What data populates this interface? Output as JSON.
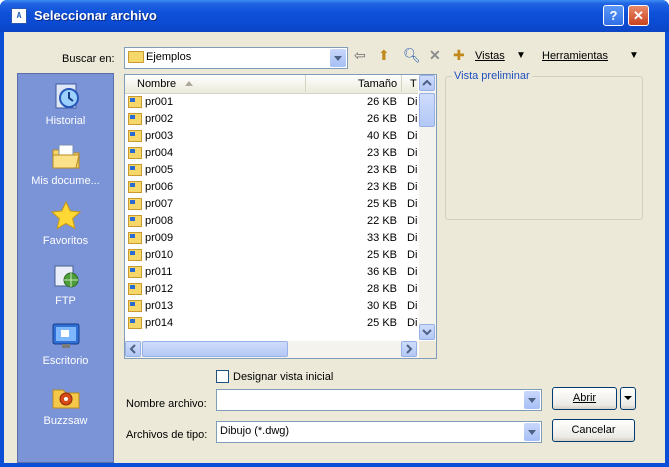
{
  "window": {
    "title": "Seleccionar archivo",
    "help_label": "?",
    "close_label": "✕"
  },
  "lookin": {
    "label": "Buscar en:",
    "value": "Ejemplos"
  },
  "toolbar": {
    "vistas": "Vistas",
    "herramientas": "Herramientas"
  },
  "places": [
    {
      "label": "Historial",
      "icon": "history-icon"
    },
    {
      "label": "Mis docume...",
      "icon": "my-documents-icon"
    },
    {
      "label": "Favoritos",
      "icon": "favorites-icon"
    },
    {
      "label": "FTP",
      "icon": "ftp-icon"
    },
    {
      "label": "Escritorio",
      "icon": "desktop-icon"
    },
    {
      "label": "Buzzsaw",
      "icon": "buzzsaw-icon"
    }
  ],
  "filelist": {
    "columns": {
      "name": "Nombre",
      "size": "Tamaño",
      "type": "T"
    },
    "rows": [
      {
        "name": "pr001",
        "size": "26 KB",
        "type": "Di"
      },
      {
        "name": "pr002",
        "size": "26 KB",
        "type": "Di"
      },
      {
        "name": "pr003",
        "size": "40 KB",
        "type": "Di"
      },
      {
        "name": "pr004",
        "size": "23 KB",
        "type": "Di"
      },
      {
        "name": "pr005",
        "size": "23 KB",
        "type": "Di"
      },
      {
        "name": "pr006",
        "size": "23 KB",
        "type": "Di"
      },
      {
        "name": "pr007",
        "size": "25 KB",
        "type": "Di"
      },
      {
        "name": "pr008",
        "size": "22 KB",
        "type": "Di"
      },
      {
        "name": "pr009",
        "size": "33 KB",
        "type": "Di"
      },
      {
        "name": "pr010",
        "size": "25 KB",
        "type": "Di"
      },
      {
        "name": "pr011",
        "size": "36 KB",
        "type": "Di"
      },
      {
        "name": "pr012",
        "size": "28 KB",
        "type": "Di"
      },
      {
        "name": "pr013",
        "size": "30 KB",
        "type": "Di"
      },
      {
        "name": "pr014",
        "size": "25 KB",
        "type": "Di"
      }
    ]
  },
  "preview": {
    "caption": "Vista preliminar"
  },
  "initial_view": {
    "label": "Designar vista inicial",
    "checked": false
  },
  "filename": {
    "label": "Nombre archivo:",
    "value": ""
  },
  "filetype": {
    "label": "Archivos de tipo:",
    "value": "Dibujo (*.dwg)"
  },
  "buttons": {
    "open": "Abrir",
    "cancel": "Cancelar"
  }
}
